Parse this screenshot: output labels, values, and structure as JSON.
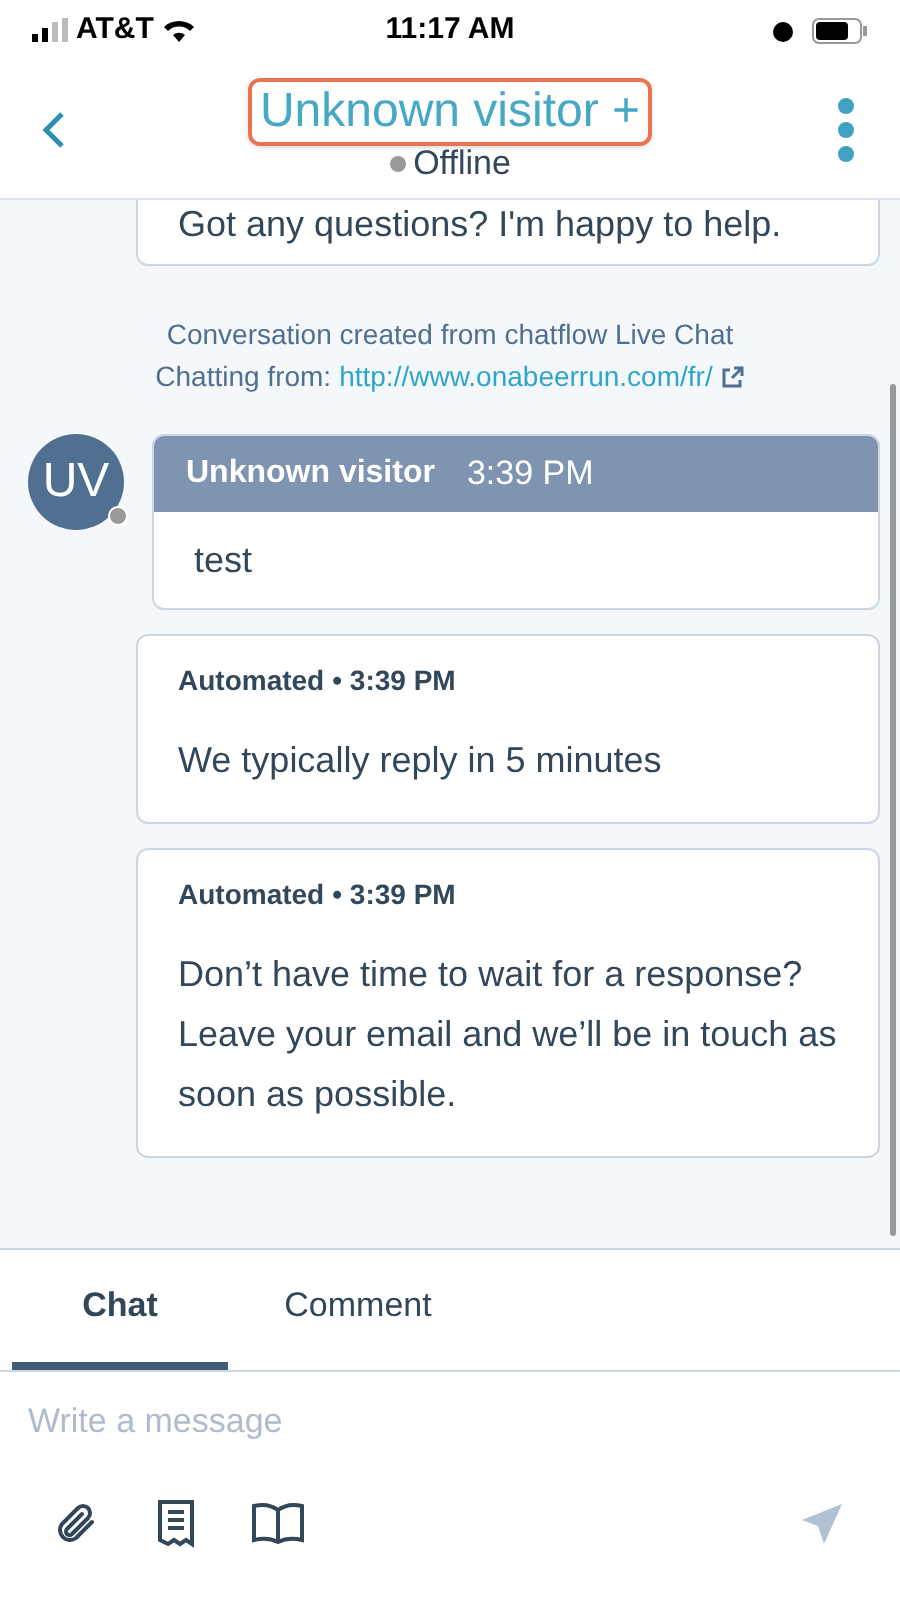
{
  "status_bar": {
    "carrier": "AT&T",
    "time": "11:17 AM"
  },
  "header": {
    "title": "Unknown visitor +",
    "status": "Offline"
  },
  "partial_message": {
    "text": "Got any questions? I'm happy to help."
  },
  "info": {
    "line1": "Conversation created from chatflow Live Chat",
    "line2_label": "Chatting from:",
    "link": "http://www.onabeerrun.com/fr/"
  },
  "messages": [
    {
      "kind": "visitor",
      "avatar": "UV",
      "sender": "Unknown visitor",
      "time": "3:39 PM",
      "text": "test"
    },
    {
      "kind": "bot",
      "sender": "Automated",
      "time": "• 3:39 PM",
      "text": "We typically reply in 5 minutes"
    },
    {
      "kind": "bot",
      "sender": "Automated",
      "time": "• 3:39 PM",
      "text": "Don’t have time to wait for a response? Leave your email and we’ll be in touch as soon as possible."
    }
  ],
  "tabs": [
    {
      "label": "Chat",
      "selected": true
    },
    {
      "label": "Comment",
      "selected": false
    }
  ],
  "composer": {
    "placeholder": "Write a message"
  }
}
